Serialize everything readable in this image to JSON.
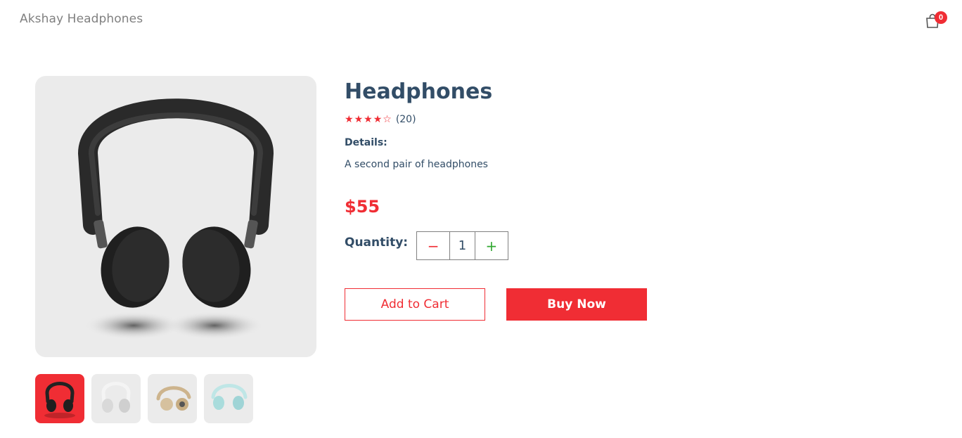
{
  "navbar": {
    "logo": "Akshay Headphones",
    "cart_icon": "shopping-bag-icon",
    "cart_count": "0"
  },
  "product": {
    "name": "Headphones",
    "rating": 4,
    "rating_max": 5,
    "review_count": "(20)",
    "details_label": "Details:",
    "details_text": "A second pair of headphones",
    "price": "$55",
    "quantity_label": "Quantity:",
    "quantity": "1",
    "minus_symbol": "−",
    "plus_symbol": "+",
    "add_to_cart_label": "Add to Cart",
    "buy_now_label": "Buy Now",
    "thumbnails": [
      {
        "name": "black-headphones",
        "selected": true
      },
      {
        "name": "white-headphones",
        "selected": false
      },
      {
        "name": "beige-headphones",
        "selected": false
      },
      {
        "name": "light-blue-headphones",
        "selected": false
      }
    ]
  },
  "colors": {
    "accent": "#f02d34",
    "heading": "#324d67",
    "image_bg": "#ebebeb",
    "plus": "#31a831"
  }
}
